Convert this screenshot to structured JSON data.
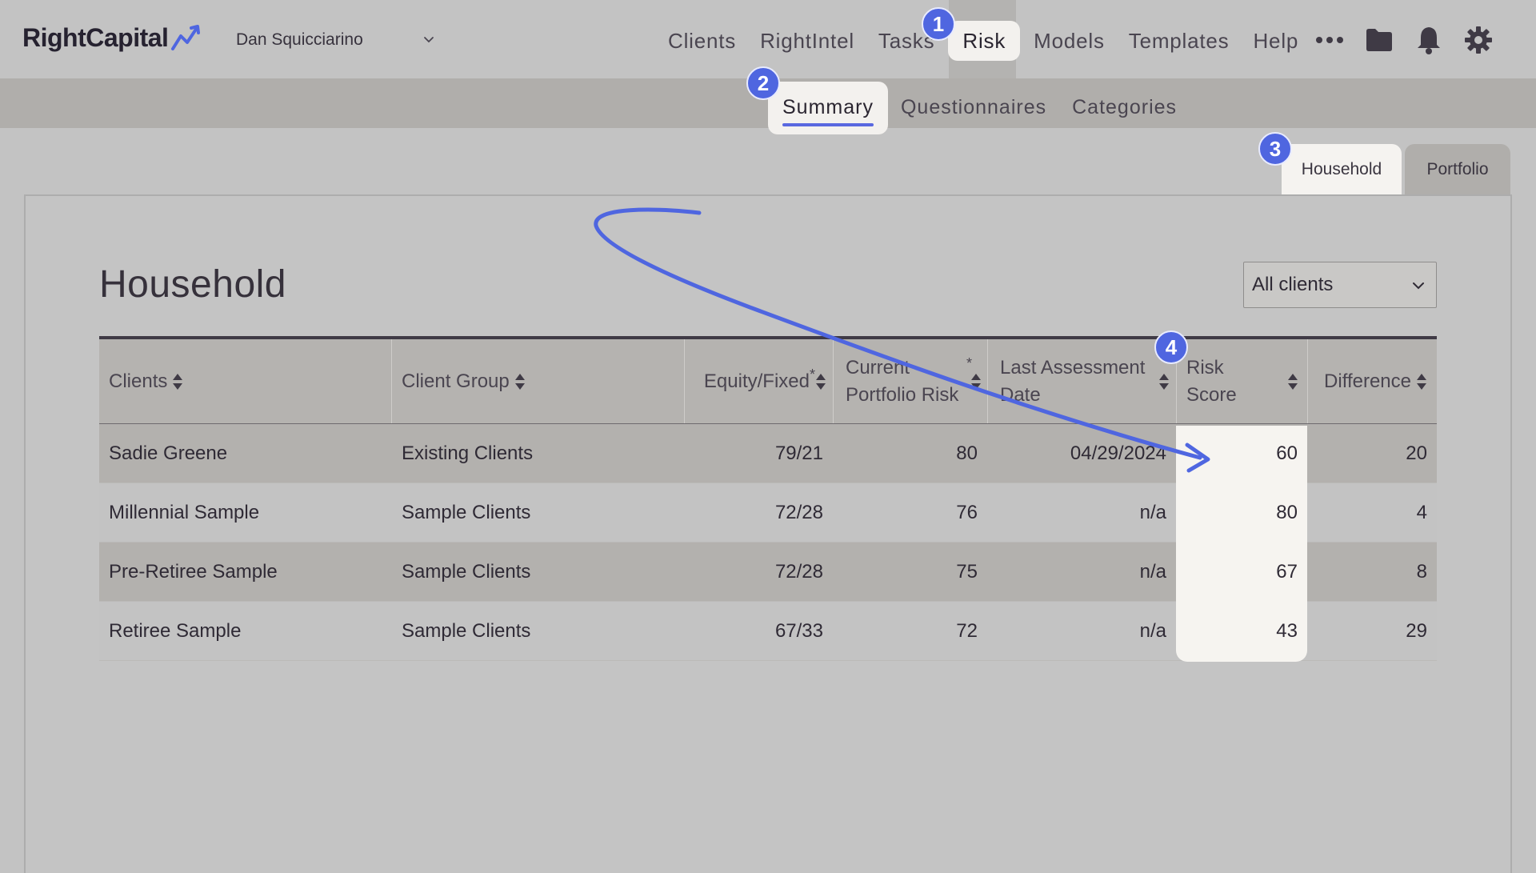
{
  "app": {
    "brand": "RightCapital",
    "user": "Dan Squicciarino"
  },
  "nav": {
    "items": [
      {
        "label": "Clients"
      },
      {
        "label": "RightIntel"
      },
      {
        "label": "Tasks"
      },
      {
        "label": "Risk",
        "active": true
      },
      {
        "label": "Models"
      },
      {
        "label": "Templates"
      },
      {
        "label": "Help"
      }
    ],
    "icons": [
      "more-icon",
      "folder-icon",
      "bell-icon",
      "gear-icon"
    ]
  },
  "subnav": {
    "items": [
      {
        "label": "Summary",
        "active": true
      },
      {
        "label": "Questionnaires"
      },
      {
        "label": "Categories"
      }
    ]
  },
  "tabs": {
    "household": "Household",
    "portfolio": "Portfolio"
  },
  "panel": {
    "title": "Household",
    "filter": "All clients"
  },
  "table": {
    "headers": {
      "clients": "Clients",
      "client_group": "Client Group",
      "equity_fixed": "Equity/Fixed",
      "equity_fixed_mark": "*",
      "current_risk_line1": "Current",
      "current_risk_line2": "Portfolio Risk",
      "current_risk_mark": "*",
      "last_assessment_line1": "Last Assessment",
      "last_assessment_line2": "Date",
      "risk_score_line1": "Risk",
      "risk_score_line2": "Score",
      "difference": "Difference"
    },
    "rows": [
      {
        "client": "Sadie Greene",
        "group": "Existing Clients",
        "equity_fixed": "79/21",
        "current_risk": "80",
        "last_assessment": "04/29/2024",
        "risk_score": "60",
        "difference": "20"
      },
      {
        "client": "Millennial Sample",
        "group": "Sample Clients",
        "equity_fixed": "72/28",
        "current_risk": "76",
        "last_assessment": "n/a",
        "risk_score": "80",
        "difference": "4"
      },
      {
        "client": "Pre-Retiree Sample",
        "group": "Sample Clients",
        "equity_fixed": "72/28",
        "current_risk": "75",
        "last_assessment": "n/a",
        "risk_score": "67",
        "difference": "8"
      },
      {
        "client": "Retiree Sample",
        "group": "Sample Clients",
        "equity_fixed": "67/33",
        "current_risk": "72",
        "last_assessment": "n/a",
        "risk_score": "43",
        "difference": "29"
      }
    ]
  },
  "annotations": {
    "badges": [
      "1",
      "2",
      "3",
      "4"
    ],
    "accent_color": "#4f66e0"
  }
}
